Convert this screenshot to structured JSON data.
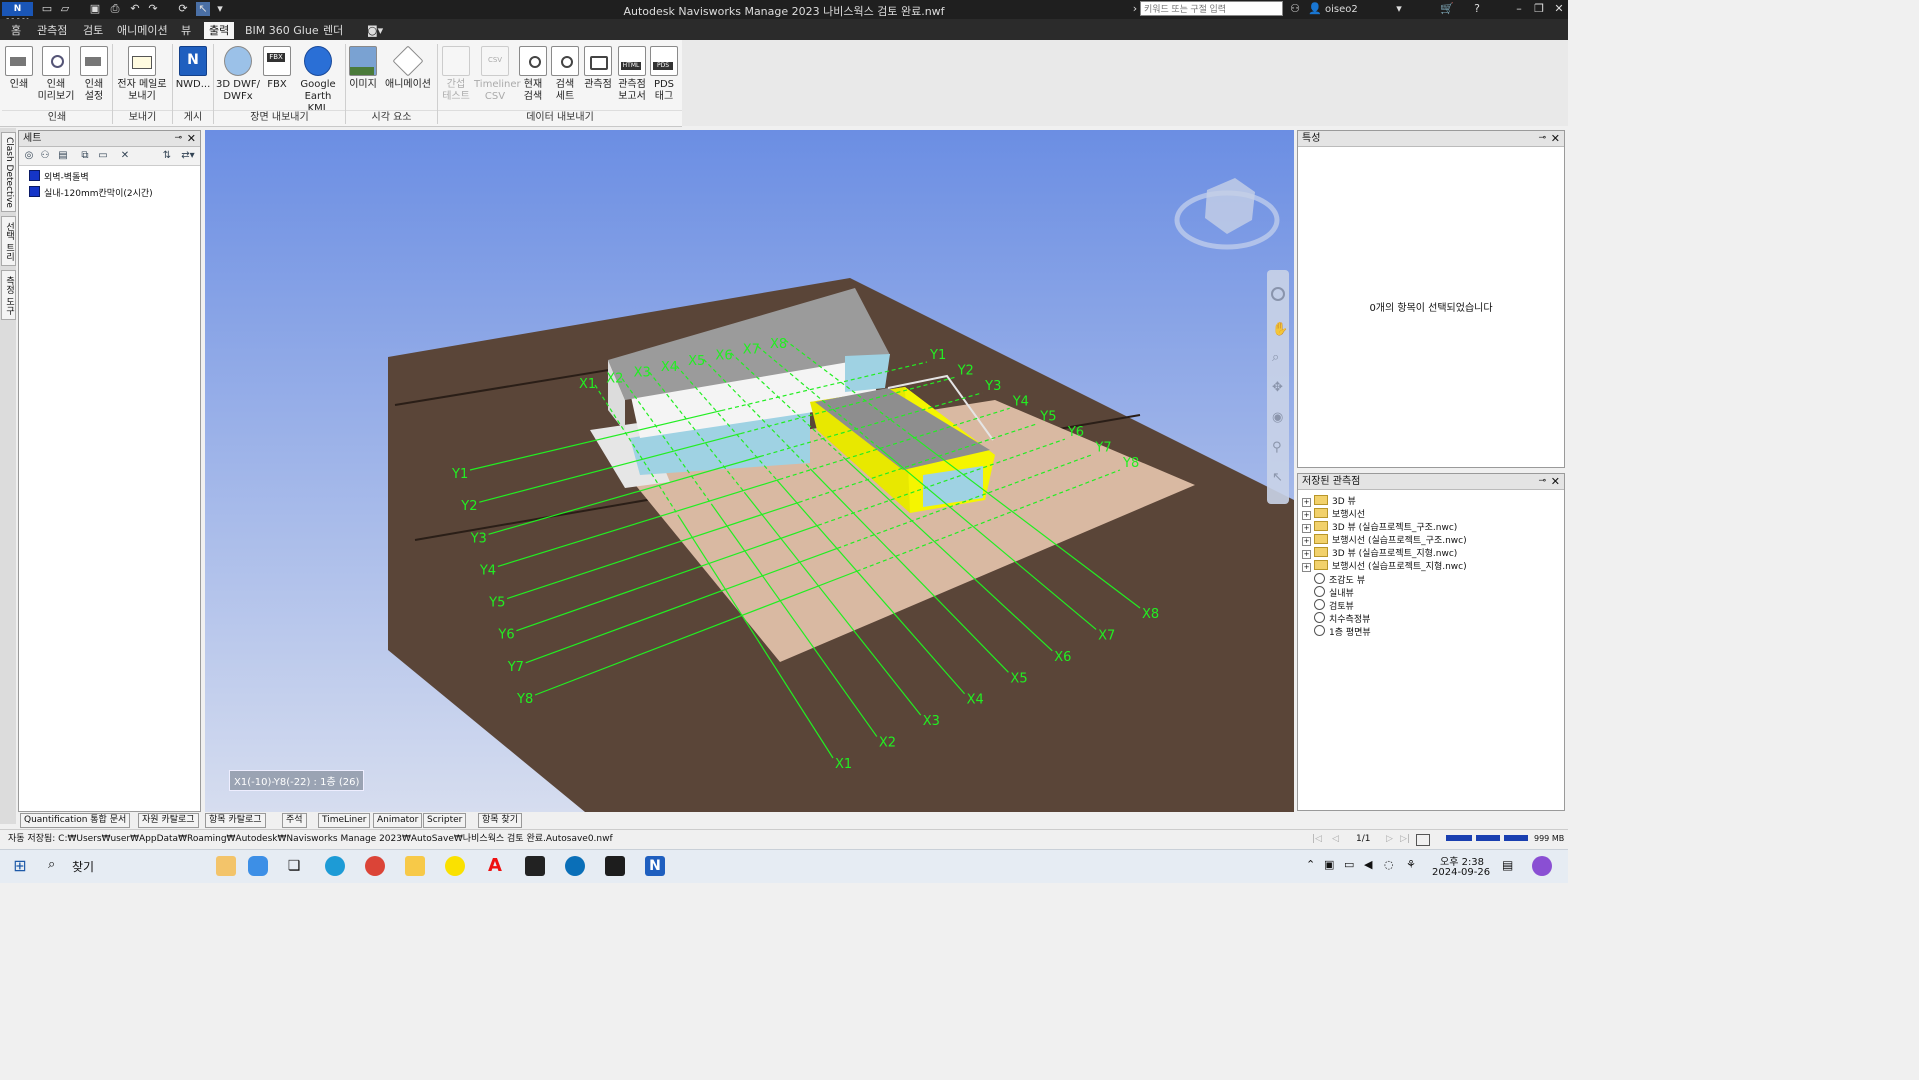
{
  "titlebar": {
    "app_logo": "N MAN",
    "title": "Autodesk Navisworks Manage 2023    나비스웍스 검토 완료.nwf",
    "search_placeholder": "키워드 또는 구절 입력",
    "user": "oiseo2"
  },
  "menu": {
    "tabs": [
      "홈",
      "관측점",
      "검토",
      "애니메이션",
      "뷰",
      "출력",
      "BIM 360 Glue",
      "렌더"
    ],
    "active": "출력"
  },
  "ribbon": {
    "buttons": [
      {
        "l1": "인쇄",
        "l2": "",
        "l3": "",
        "icon": "print-icon"
      },
      {
        "l1": "인쇄",
        "l2": "미리보기",
        "l3": "",
        "icon": "print-preview-icon"
      },
      {
        "l1": "인쇄",
        "l2": "설정",
        "l3": "",
        "icon": "print-setup-icon"
      },
      {
        "l1": "전자 메일로",
        "l2": "보내기",
        "l3": "",
        "icon": "email-icon"
      },
      {
        "l1": "NWD...",
        "l2": "",
        "l3": "",
        "icon": "nwd-icon"
      },
      {
        "l1": "3D DWF/",
        "l2": "DWFx",
        "l3": "",
        "icon": "dwf-icon"
      },
      {
        "l1": "FBX",
        "l2": "",
        "l3": "",
        "icon": "fbx-icon"
      },
      {
        "l1": "Google",
        "l2": "Earth KML",
        "l3": "",
        "icon": "google-earth-icon"
      },
      {
        "l1": "이미지",
        "l2": "",
        "l3": "",
        "icon": "image-icon"
      },
      {
        "l1": "애니메이션",
        "l2": "",
        "l3": "",
        "icon": "animation-icon"
      },
      {
        "l1": "간섭",
        "l2": "테스트",
        "l3": "",
        "icon": "clash-test-icon"
      },
      {
        "l1": "Timeliner",
        "l2": "CSV",
        "l3": "",
        "icon": "csv-icon"
      },
      {
        "l1": "현재",
        "l2": "검색",
        "l3": "",
        "icon": "current-search-icon"
      },
      {
        "l1": "검색",
        "l2": "세트",
        "l3": "",
        "icon": "search-set-icon"
      },
      {
        "l1": "관측점",
        "l2": "",
        "l3": "",
        "icon": "viewpoint-icon"
      },
      {
        "l1": "관측점",
        "l2": "보고서",
        "l3": "",
        "icon": "html-report-icon"
      },
      {
        "l1": "PDS",
        "l2": "태그",
        "l3": "",
        "icon": "pds-icon"
      }
    ],
    "groups": [
      "인쇄",
      "보내기",
      "게시",
      "장면 내보내기",
      "시각 요소",
      "데이터 내보내기"
    ]
  },
  "sidetabs": [
    "Clash Detective",
    "선택 트리",
    "측정 도구"
  ],
  "sets": {
    "title": "세트",
    "items": [
      "외벽-벽돌벽",
      "실내-120mm칸막이(2시간)"
    ]
  },
  "viewport": {
    "grid_x": [
      "X1",
      "X2",
      "X3",
      "X4",
      "X5",
      "X6",
      "X7",
      "X8"
    ],
    "grid_y": [
      "Y1",
      "Y2",
      "Y3",
      "Y4",
      "Y5",
      "Y6",
      "Y7",
      "Y8"
    ],
    "location_readout": "X1(-10)-Y8(-22) : 1층 (26)"
  },
  "properties": {
    "title": "특성",
    "message": "0개의 항목이 선택되었습니다"
  },
  "saved_viewpoints": {
    "title": "저장된 관측점",
    "folders": [
      "3D 뷰",
      "보행시선",
      "3D 뷰 (실습프로젝트_구조.nwc)",
      "보행시선 (실습프로젝트_구조.nwc)",
      "3D 뷰 (실습프로젝트_지형.nwc)",
      "보행시선 (실습프로젝트_지형.nwc)"
    ],
    "views": [
      "조감도 뷰",
      "실내뷰",
      "검토뷰",
      "치수측정뷰",
      "1층 평면뷰"
    ]
  },
  "bottom_tabs": [
    "Quantification 통합 문서",
    "자원 카탈로그",
    "항목 카탈로그",
    "주석",
    "TimeLiner",
    "Animator",
    "Scripter",
    "항목 찾기"
  ],
  "status": {
    "autosave": "자동 저장됨: C:₩Users₩user₩AppData₩Roaming₩Autodesk₩Navisworks Manage 2023₩AutoSave₩나비스웍스 검토 완료.Autosave0.nwf",
    "page": "1/1",
    "memory": "999 MB"
  },
  "taskbar": {
    "search_label": "찾기",
    "time": "오후 2:38",
    "date": "2024-09-26"
  },
  "colors": {
    "grid": "#22ee22",
    "ground": "#5a4538",
    "sky_top": "#6f8fe0",
    "sky_bottom": "#d4dcef",
    "selection": "#f0f000"
  }
}
